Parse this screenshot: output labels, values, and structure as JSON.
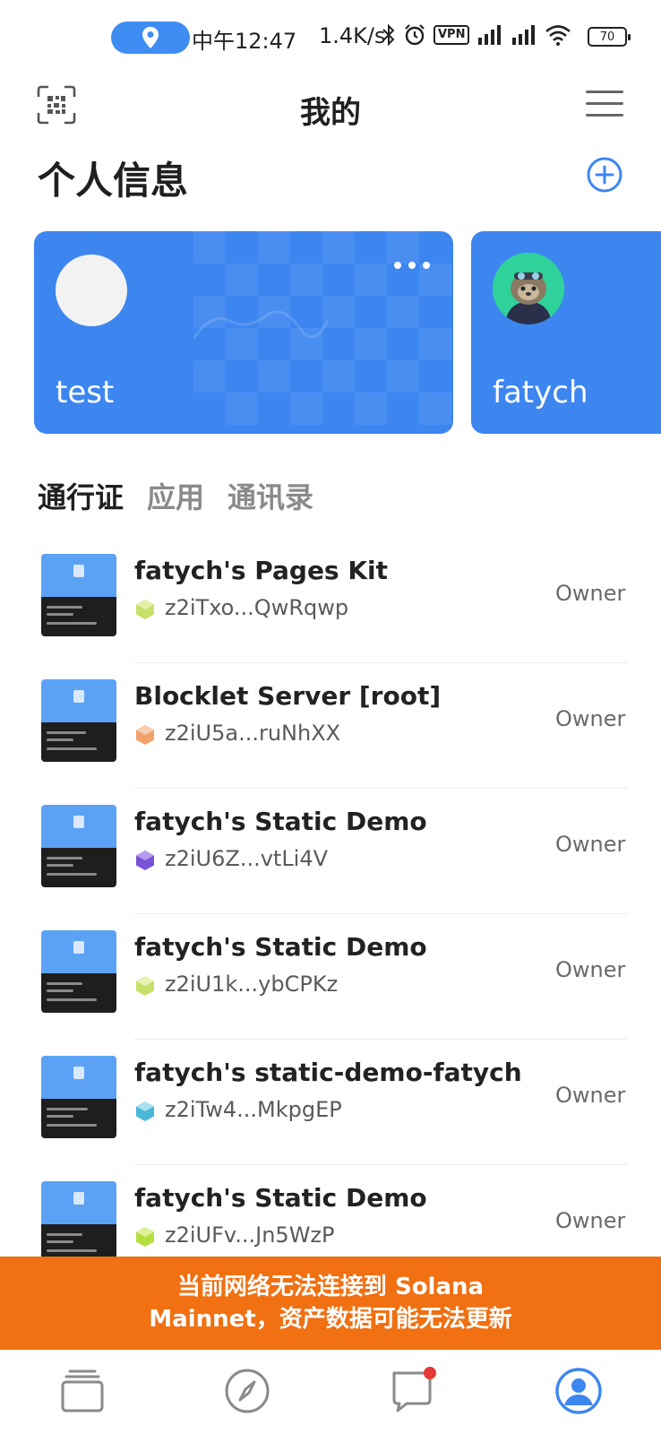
{
  "status_bar": {
    "time": "中午12:47",
    "network_speed": "1.4K/s",
    "vpn": "VPN",
    "battery": "70"
  },
  "header": {
    "title": "我的"
  },
  "section": {
    "title": "个人信息"
  },
  "cards": [
    {
      "name": "test"
    },
    {
      "name": "fatych"
    }
  ],
  "tabs": [
    {
      "label": "通行证",
      "active": true
    },
    {
      "label": "应用",
      "active": false
    },
    {
      "label": "通讯录",
      "active": false
    }
  ],
  "list": [
    {
      "title": "fatych's Pages Kit",
      "id": "z2iTxo...QwRqwp",
      "role": "Owner",
      "icon_color": "#c7e06a"
    },
    {
      "title": "Blocklet Server [root]",
      "id": "z2iU5a...ruNhXX",
      "role": "Owner",
      "icon_color": "#f0a16a"
    },
    {
      "title": "fatych's Static Demo",
      "id": "z2iU6Z...vtLi4V",
      "role": "Owner",
      "icon_color": "#7a52d8"
    },
    {
      "title": "fatych's Static Demo",
      "id": "z2iU1k...ybCPKz",
      "role": "Owner",
      "icon_color": "#c7e06a"
    },
    {
      "title": "fatych's static-demo-fatych",
      "id": "z2iTw4...MkpgEP",
      "role": "Owner",
      "icon_color": "#4ab6d8"
    },
    {
      "title": "fatych's Static Demo",
      "id": "z2iUFv...Jn5WzP",
      "role": "Owner",
      "icon_color": "#b5df3e"
    }
  ],
  "banner": {
    "line1": "当前网络无法连接到 Solana",
    "line2": "Mainnet，资产数据可能无法更新"
  },
  "colors": {
    "accent": "#3d86f0",
    "banner": "#f07012",
    "notification_dot": "#e53935"
  }
}
